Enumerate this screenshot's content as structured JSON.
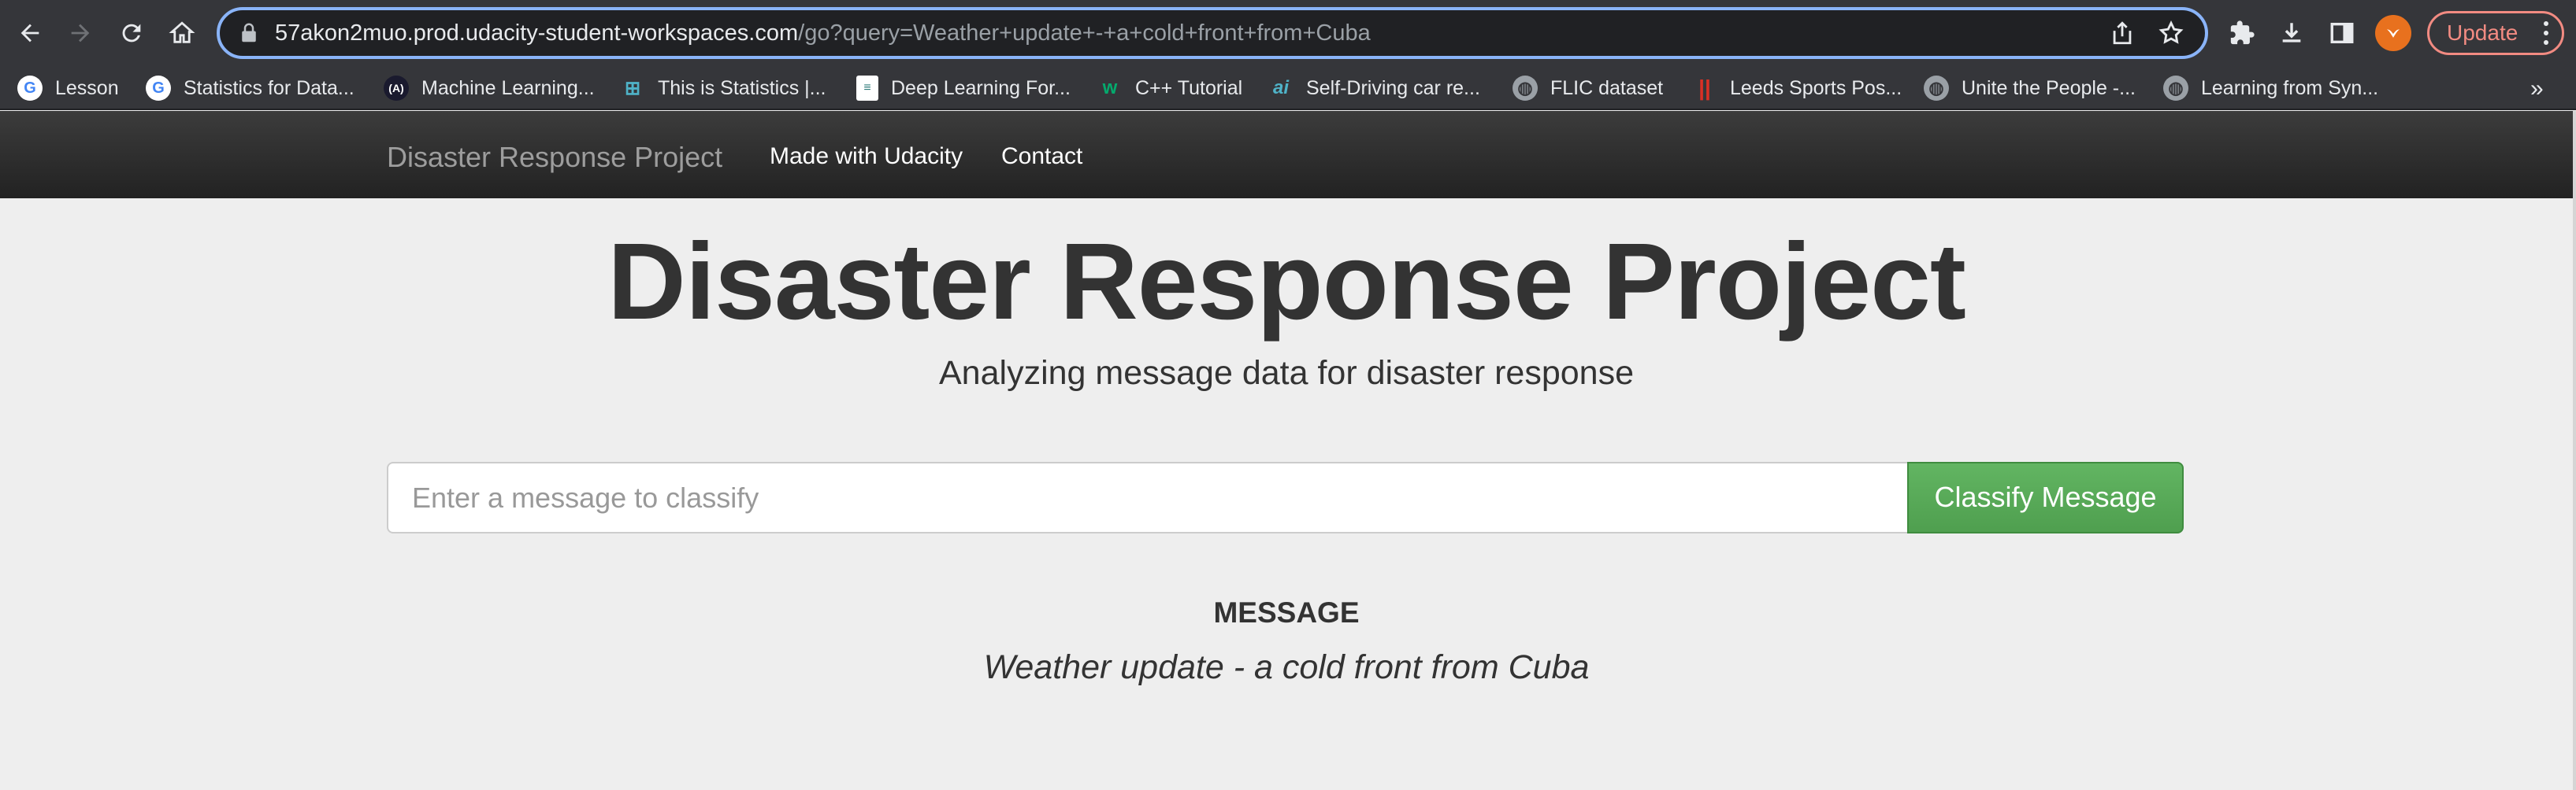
{
  "browser": {
    "url_host": "57akon2muo.prod.udacity-student-workspaces.com",
    "url_path": "/go?query=Weather+update+-+a+cold+front+from+Cuba",
    "update_label": "Update",
    "icons": [
      "back-icon",
      "forward-icon",
      "reload-icon",
      "home-icon",
      "lock-icon",
      "share-icon",
      "star-icon",
      "extensions-icon",
      "download-icon",
      "side-panel-icon",
      "profile-avatar",
      "menu-icon"
    ]
  },
  "bookmarks": [
    {
      "label": "Lesson",
      "icon": "google-icon"
    },
    {
      "label": "Statistics for Data...",
      "icon": "google-icon"
    },
    {
      "label": "Machine Learning...",
      "icon": "ml-icon"
    },
    {
      "label": "This is Statistics |...",
      "icon": "grid-icon"
    },
    {
      "label": "Deep Learning For...",
      "icon": "doc-icon"
    },
    {
      "label": "C++ Tutorial",
      "icon": "w3-icon"
    },
    {
      "label": "Self-Driving car re...",
      "icon": "ai-icon"
    },
    {
      "label": "FLIC dataset",
      "icon": "globe-icon"
    },
    {
      "label": "Leeds Sports Pos...",
      "icon": "leeds-icon"
    },
    {
      "label": "Unite the People -...",
      "icon": "globe-icon"
    },
    {
      "label": "Learning from Syn...",
      "icon": "globe-icon"
    }
  ],
  "navbar": {
    "brand": "Disaster Response Project",
    "links": [
      "Made with Udacity",
      "Contact"
    ]
  },
  "hero": {
    "title": "Disaster Response Project",
    "subtitle": "Analyzing message data for disaster response"
  },
  "form": {
    "placeholder": "Enter a message to classify",
    "value": "",
    "button_label": "Classify Message"
  },
  "result": {
    "label": "MESSAGE",
    "message": "Weather update - a cold front from Cuba"
  },
  "colors": {
    "chrome": "#35363a",
    "omnibox_border": "#8ab4f8",
    "navbar": "#222222",
    "page_bg": "#eeeeee",
    "button": "#5cb85c",
    "update": "#f28b82"
  }
}
